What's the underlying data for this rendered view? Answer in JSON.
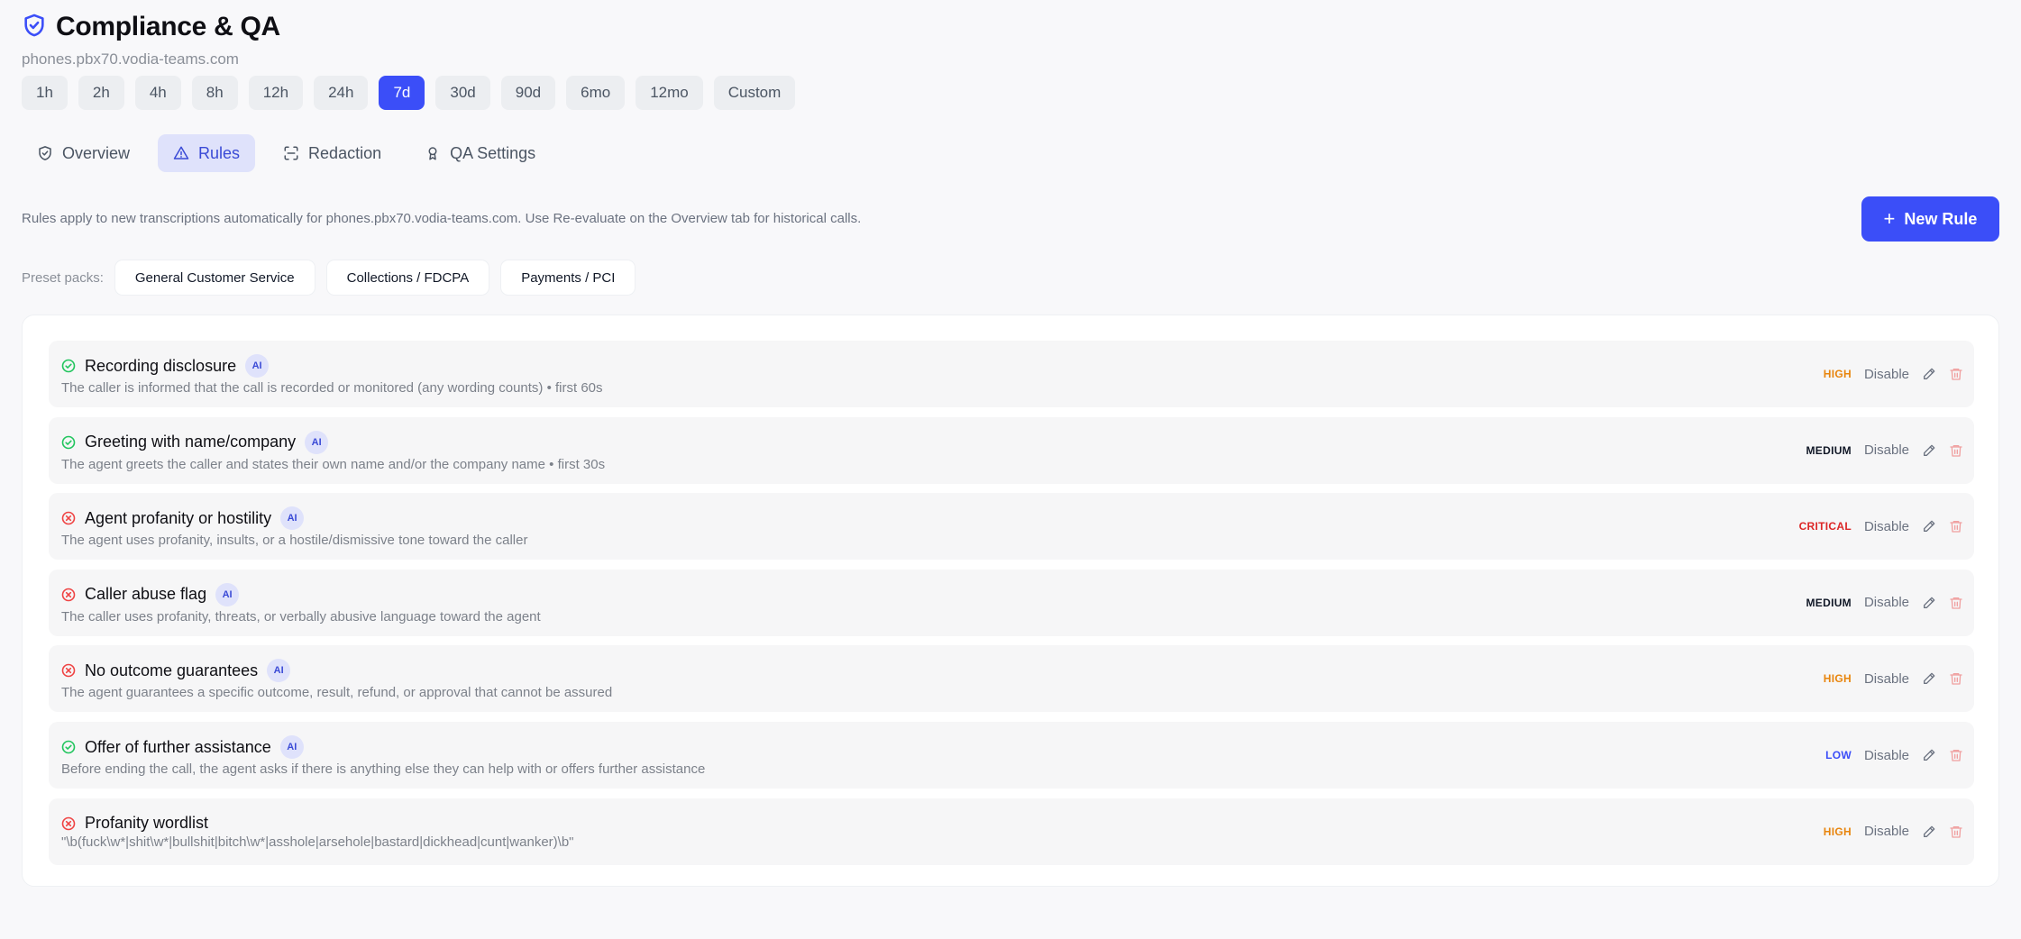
{
  "header": {
    "title": "Compliance & QA",
    "subtitle": "phones.pbx70.vodia-teams.com"
  },
  "time_ranges": [
    "1h",
    "2h",
    "4h",
    "8h",
    "12h",
    "24h",
    "7d",
    "30d",
    "90d",
    "6mo",
    "12mo",
    "Custom"
  ],
  "active_range": "7d",
  "tabs": [
    {
      "label": "Overview",
      "icon": "shield-check-icon"
    },
    {
      "label": "Rules",
      "icon": "warning-triangle-icon"
    },
    {
      "label": "Redaction",
      "icon": "scan-icon"
    },
    {
      "label": "QA Settings",
      "icon": "award-icon"
    }
  ],
  "active_tab": "Rules",
  "info_text": "Rules apply to new transcriptions automatically for phones.pbx70.vodia-teams.com. Use Re-evaluate on the Overview tab for historical calls.",
  "new_rule_label": "New Rule",
  "presets": {
    "label": "Preset packs:",
    "items": [
      "General Customer Service",
      "Collections / FDCPA",
      "Payments / PCI"
    ]
  },
  "actions": {
    "disable_label": "Disable"
  },
  "ai_badge_label": "AI",
  "colors": {
    "accent": "#3b4ef8",
    "high": "#e8850d",
    "critical": "#dc2626",
    "pass": "#22c55e",
    "fail": "#ef4444"
  },
  "rules": [
    {
      "name": "Recording disclosure",
      "ai": true,
      "status": "pass",
      "description": "The caller is informed that the call is recorded or monitored (any wording counts) • first 60s",
      "severity": "HIGH"
    },
    {
      "name": "Greeting with name/company",
      "ai": true,
      "status": "pass",
      "description": "The agent greets the caller and states their own name and/or the company name • first 30s",
      "severity": "MEDIUM"
    },
    {
      "name": "Agent profanity or hostility",
      "ai": true,
      "status": "fail",
      "description": "The agent uses profanity, insults, or a hostile/dismissive tone toward the caller",
      "severity": "CRITICAL"
    },
    {
      "name": "Caller abuse flag",
      "ai": true,
      "status": "fail",
      "description": "The caller uses profanity, threats, or verbally abusive language toward the agent",
      "severity": "MEDIUM"
    },
    {
      "name": "No outcome guarantees",
      "ai": true,
      "status": "fail",
      "description": "The agent guarantees a specific outcome, result, refund, or approval that cannot be assured",
      "severity": "HIGH"
    },
    {
      "name": "Offer of further assistance",
      "ai": true,
      "status": "pass",
      "description": "Before ending the call, the agent asks if there is anything else they can help with or offers further assistance",
      "severity": "LOW"
    },
    {
      "name": "Profanity wordlist",
      "ai": false,
      "status": "fail",
      "description": "\"\\b(fuck\\w*|shit\\w*|bullshit|bitch\\w*|asshole|arsehole|bastard|dickhead|cunt|wanker)\\b\"",
      "severity": "HIGH"
    }
  ]
}
